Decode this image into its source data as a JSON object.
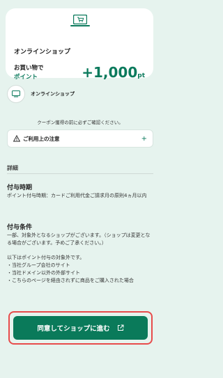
{
  "card": {
    "title": "オンラインショップ",
    "label_line1": "お買い物で",
    "label_line2": "ポイント",
    "amount": "+1,000",
    "unit": "pt"
  },
  "shop": {
    "name": "オンラインショップ"
  },
  "notice": "クーポン獲得の前に必ずご確認ください。",
  "caution": {
    "label": "ご利用上の注意"
  },
  "details": {
    "heading": "詳細",
    "timing_title": "付与時期",
    "timing_text": "ポイント付与時期：カードご利用代金ご請求月の原則4ヵ月以内",
    "conditions_title": "付与条件",
    "conditions_text": "一部、対象外となるショップがございます。（ショップは変更となる場合がございます。予めご了承ください。）",
    "exclusions_intro": "以下はポイント付与の対象外です。",
    "exclusions": [
      "・当社グループ会社のサイト",
      "・当社ドメイン以外の外部サイト",
      "・こちらのページを経由されずに商品をご購入された場合"
    ]
  },
  "cta": {
    "label": "同意してショップに進む"
  },
  "colors": {
    "accent": "#0b7a5c",
    "background": "#e6f3ee",
    "highlight": "#e84b4b"
  }
}
